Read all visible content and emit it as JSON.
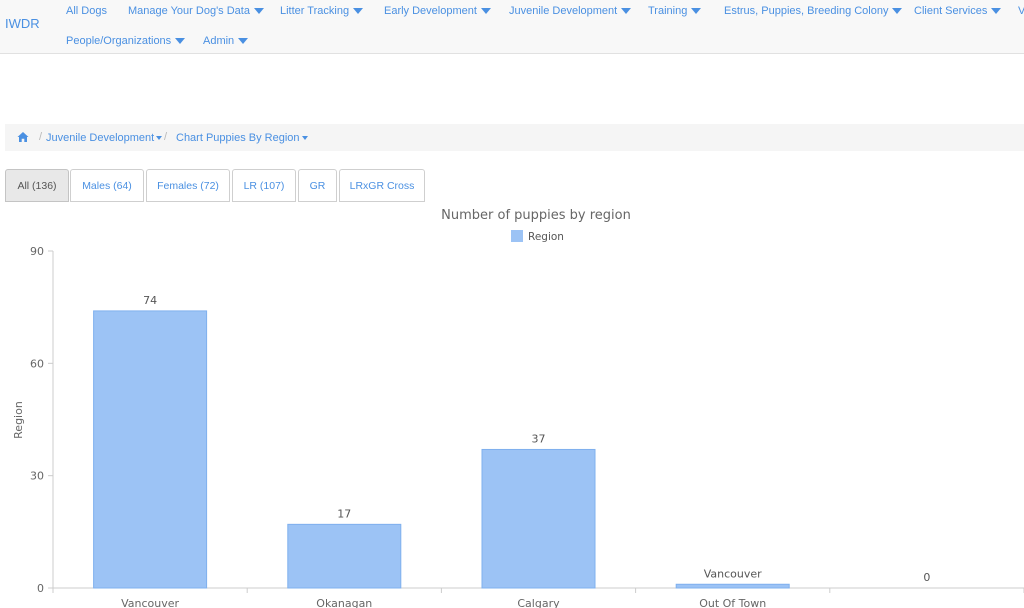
{
  "app": {
    "brand": "IWDR"
  },
  "nav": {
    "items": [
      {
        "label": "All Dogs",
        "caret": false
      },
      {
        "label": "Manage Your Dog's Data",
        "caret": true
      },
      {
        "label": "Litter Tracking",
        "caret": true
      },
      {
        "label": "Early Development",
        "caret": true
      },
      {
        "label": "Juvenile Development",
        "caret": true
      },
      {
        "label": "Training",
        "caret": true
      },
      {
        "label": "Estrus, Puppies, Breeding Colony",
        "caret": true
      },
      {
        "label": "Client Services",
        "caret": true
      },
      {
        "label": "V",
        "caret": false
      },
      {
        "label": "People/Organizations",
        "caret": true
      },
      {
        "label": "Admin",
        "caret": true
      }
    ]
  },
  "breadcrumb": {
    "home_icon": "home-icon",
    "items": [
      "Juvenile Development",
      "Chart Puppies By Region"
    ],
    "separator": "/"
  },
  "tabs": [
    {
      "label": "All (136)",
      "active": true
    },
    {
      "label": "Males (64)",
      "active": false
    },
    {
      "label": "Females (72)",
      "active": false
    },
    {
      "label": "LR (107)",
      "active": false
    },
    {
      "label": "GR",
      "active": false
    },
    {
      "label": "LRxGR Cross",
      "active": false
    }
  ],
  "chart_data": {
    "type": "bar",
    "title": "Number of puppies by region",
    "legend": [
      "Region"
    ],
    "legend_position": "top-center",
    "ylabel": "Region",
    "xlabel": "",
    "ylim": [
      0,
      90
    ],
    "yticks": [
      0,
      30,
      60,
      90
    ],
    "grid": false,
    "categories": [
      "Vancouver",
      "Okanagan",
      "Calgary",
      "Out Of Town",
      ""
    ],
    "series": [
      {
        "name": "Region",
        "values": [
          74,
          17,
          37,
          1,
          0
        ],
        "color": "#9cc3f5"
      }
    ],
    "data_labels": [
      "74",
      "17",
      "37",
      "Vancouver",
      "0"
    ]
  },
  "colors": {
    "link": "#4a90e2",
    "bar": "#9cc3f5",
    "bar_border": "#7fb0ee",
    "axis_text": "#666666"
  }
}
